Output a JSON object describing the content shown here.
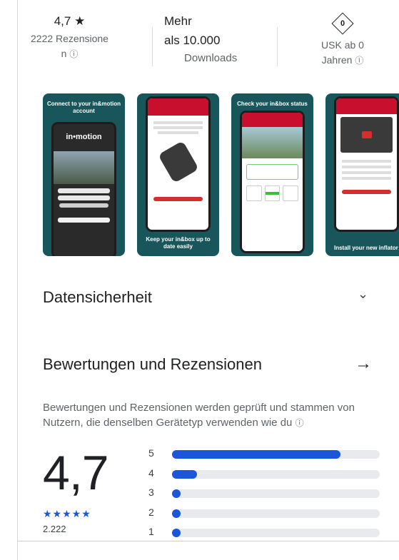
{
  "stats": {
    "rating_value": "4,7",
    "rating_star": "★",
    "reviews_line1": "2222 Rezensione",
    "reviews_line2": "n",
    "downloads_line1": "Mehr",
    "downloads_line2": "als 10.000",
    "downloads_line3": "Downloads",
    "usk_badge": "0",
    "usk_line1": "USK ab 0",
    "usk_line2": "Jahren",
    "info_icon": "ⓘ"
  },
  "screenshots": [
    {
      "caption": "Connect to your in&motion account",
      "logo": "in•motion"
    },
    {
      "caption": "Keep your in&box up to date easily",
      "header": "My in&box"
    },
    {
      "caption": "Check your in&box status",
      "header": "My in&box"
    },
    {
      "caption": "Install your new inflator",
      "header": "My in&box"
    }
  ],
  "data_safety": {
    "title": "Datensicherheit",
    "icon": "chevron-down-icon",
    "glyph": "⌄"
  },
  "ratings": {
    "title": "Bewertungen und Rezensionen",
    "arrow_glyph": "→",
    "description": "Bewertungen und Rezensionen werden geprüft und stammen von Nutzern, die denselben Gerätetyp verwenden wie du",
    "info_icon": "ⓘ",
    "average": "4,7",
    "stars": "★★★★★",
    "total": "2.222",
    "accent": "#1a56d9",
    "distribution": [
      {
        "label": "5",
        "fraction": 0.81
      },
      {
        "label": "4",
        "fraction": 0.12
      },
      {
        "label": "3",
        "fraction": 0.03
      },
      {
        "label": "2",
        "fraction": 0.03
      },
      {
        "label": "1",
        "fraction": 0.03
      }
    ]
  }
}
